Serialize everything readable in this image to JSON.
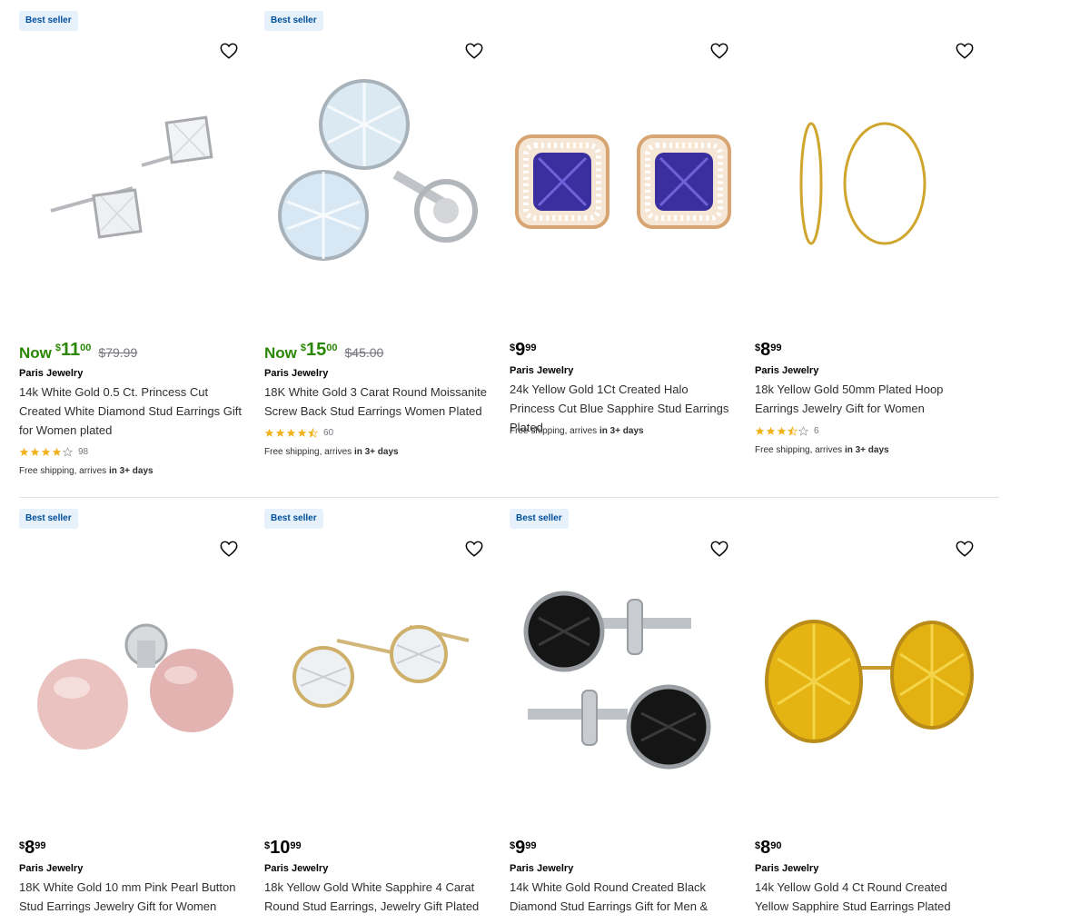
{
  "colors": {
    "badge_bg": "#e6f1fc",
    "badge_text": "#004f9a",
    "sale_green": "#2a8703",
    "star": "#f2b21c"
  },
  "products": [
    {
      "badge": "Best seller",
      "sale": true,
      "now_label": "Now",
      "price_symbol": "$",
      "price_dollars": "11",
      "price_cents": "00",
      "was_price": "$79.99",
      "brand": "Paris Jewelry",
      "title": "14k White Gold 0.5 Ct. Princess Cut Created White Diamond Stud Earrings Gift for Women plated",
      "rating": 4,
      "review_count": "98",
      "shipping_prefix": "Free shipping, arrives",
      "shipping_bold": "in 3+ days",
      "image_icon": "princess-cut-stud-earrings"
    },
    {
      "badge": "Best seller",
      "sale": true,
      "now_label": "Now",
      "price_symbol": "$",
      "price_dollars": "15",
      "price_cents": "00",
      "was_price": "$45.00",
      "brand": "Paris Jewelry",
      "title": "18K White Gold 3 Carat Round Moissanite Screw Back Stud Earrings Women Plated",
      "rating": 4.5,
      "review_count": "60",
      "shipping_prefix": "Free shipping, arrives",
      "shipping_bold": "in 3+ days",
      "image_icon": "round-moissanite-stud-earrings"
    },
    {
      "badge": "",
      "sale": false,
      "price_symbol": "$",
      "price_dollars": "9",
      "price_cents": "99",
      "brand": "Paris Jewelry",
      "title": "24k Yellow Gold 1Ct Created Halo Princess Cut Blue Sapphire Stud Earrings Plated",
      "shipping_prefix": "Free shipping, arrives",
      "shipping_bold": "in 3+ days",
      "image_icon": "blue-sapphire-halo-earrings"
    },
    {
      "badge": "",
      "sale": false,
      "price_symbol": "$",
      "price_dollars": "8",
      "price_cents": "99",
      "brand": "Paris Jewelry",
      "title": "18k Yellow Gold 50mm Plated Hoop Earrings Jewelry Gift for Women",
      "rating": 3.5,
      "review_count": "6",
      "shipping_prefix": "Free shipping, arrives",
      "shipping_bold": "in 3+ days",
      "image_icon": "gold-hoop-earrings"
    },
    {
      "badge": "Best seller",
      "sale": false,
      "price_symbol": "$",
      "price_dollars": "8",
      "price_cents": "99",
      "brand": "Paris Jewelry",
      "title": "18K White Gold 10 mm Pink Pearl Button Stud Earrings Jewelry Gift for Women",
      "image_icon": "pink-pearl-earrings"
    },
    {
      "badge": "Best seller",
      "sale": false,
      "price_symbol": "$",
      "price_dollars": "10",
      "price_cents": "99",
      "brand": "Paris Jewelry",
      "title": "18k Yellow Gold White Sapphire 4 Carat Round Stud Earrings, Jewelry Gift Plated",
      "image_icon": "white-sapphire-stud-earrings"
    },
    {
      "badge": "Best seller",
      "sale": false,
      "price_symbol": "$",
      "price_dollars": "9",
      "price_cents": "99",
      "brand": "Paris Jewelry",
      "title": "14k White Gold Round Created Black Diamond Stud Earrings Gift for Men &",
      "image_icon": "black-diamond-stud-earrings"
    },
    {
      "badge": "",
      "sale": false,
      "price_symbol": "$",
      "price_dollars": "8",
      "price_cents": "90",
      "brand": "Paris Jewelry",
      "title": "14k Yellow Gold 4 Ct Round Created Yellow Sapphire Stud Earrings Plated",
      "image_icon": "yellow-sapphire-stud-earrings"
    }
  ]
}
